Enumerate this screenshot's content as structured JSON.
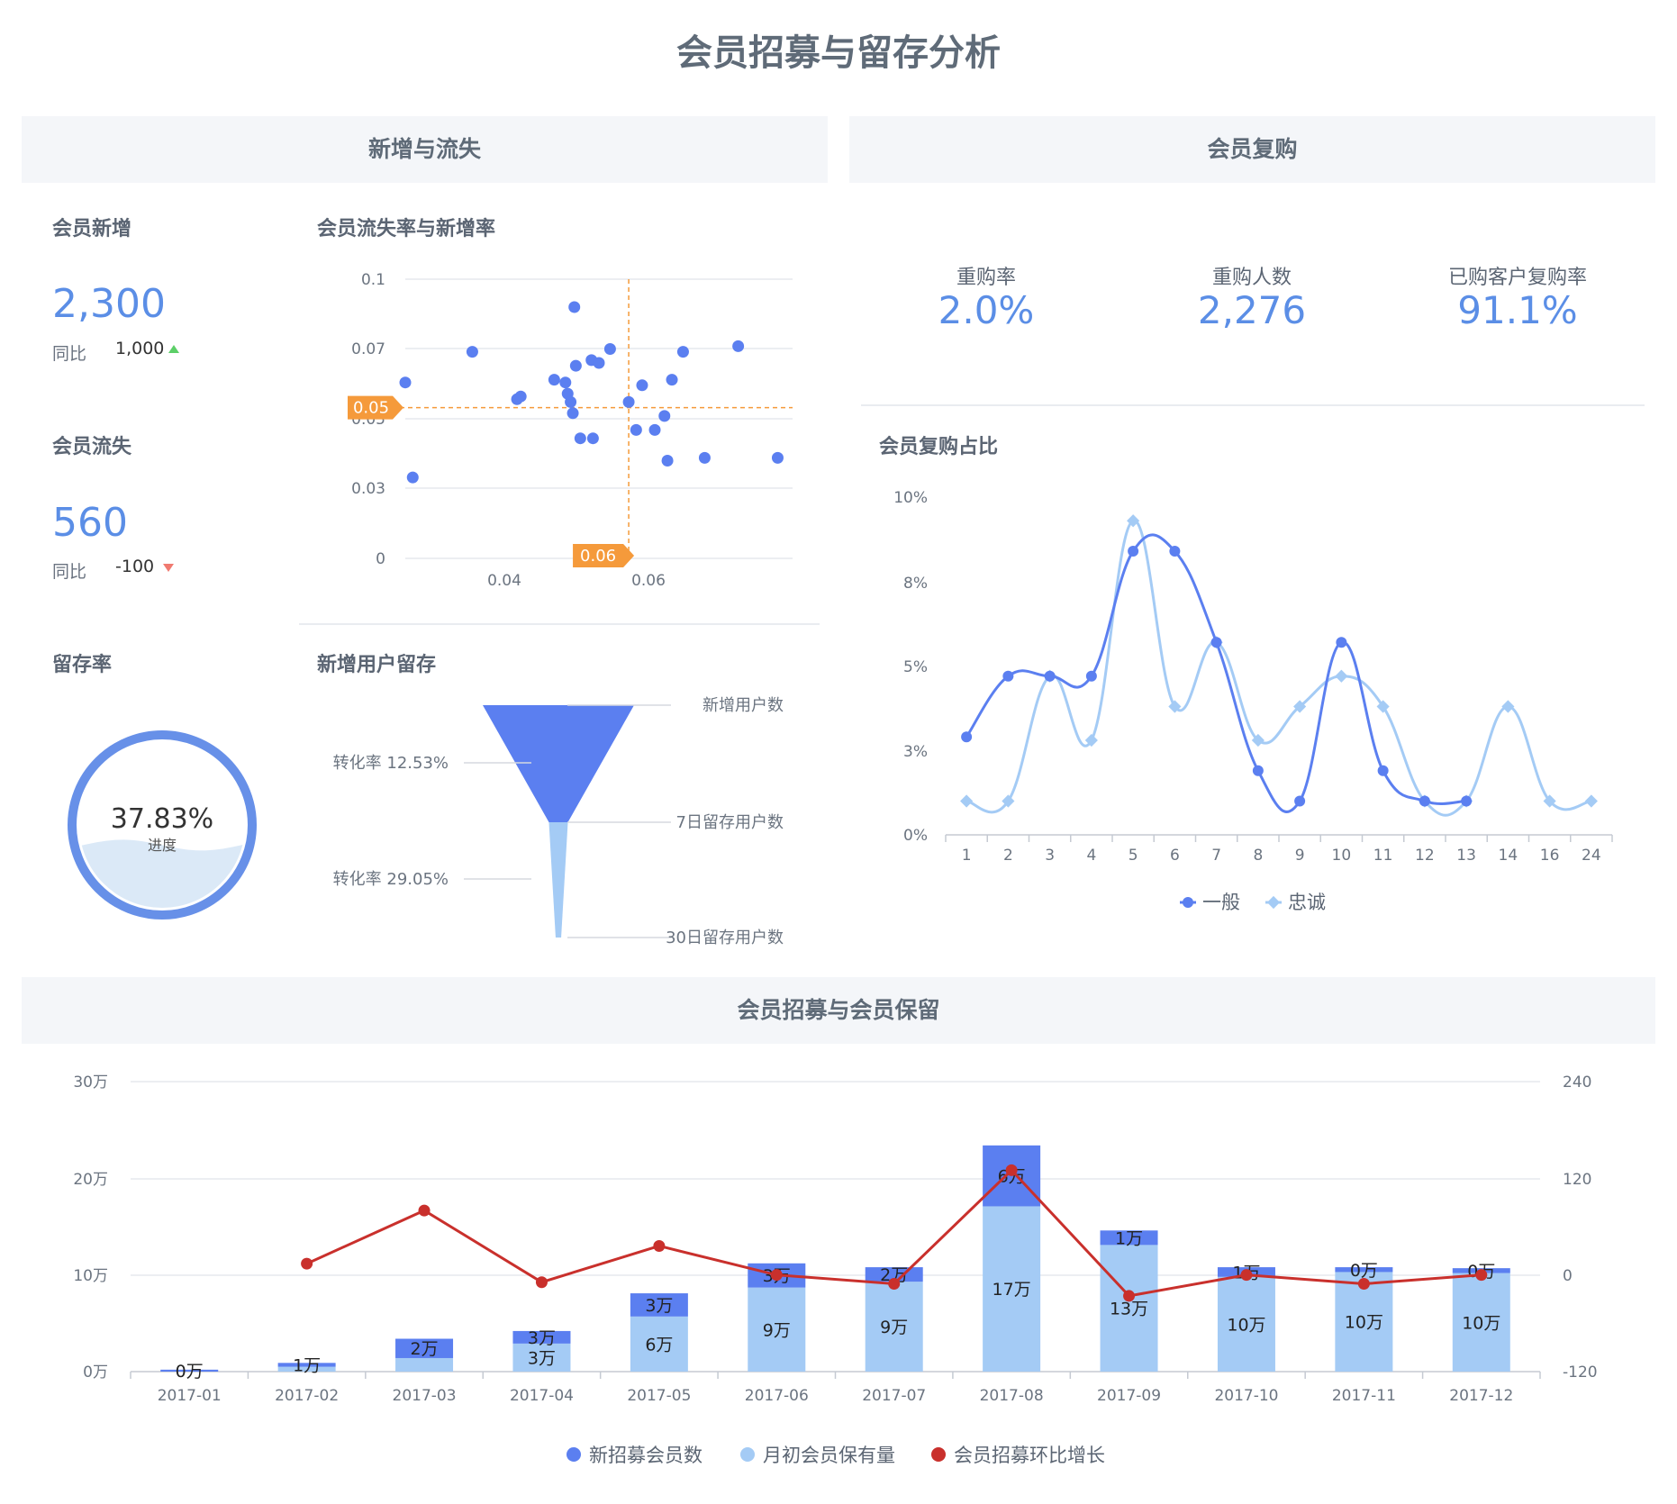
{
  "page_title": "会员招募与留存分析",
  "sections": {
    "new_and_lost": "新增与流失",
    "repurchase": "会员复购",
    "recruit_retain": "会员招募与会员保留"
  },
  "new_members": {
    "title": "会员新增",
    "value": "2,300",
    "yoy_label": "同比",
    "yoy_value": "1,000",
    "trend": "up"
  },
  "lost_members": {
    "title": "会员流失",
    "value": "560",
    "yoy_label": "同比",
    "yoy_value": "-100",
    "trend": "down"
  },
  "retention": {
    "title": "留存率",
    "value": "37.83%",
    "caption": "进度",
    "fraction": 0.3783
  },
  "funnel_title": "新增用户留存",
  "repurchase_kpis": [
    {
      "label": "重购率",
      "value": "2.0%"
    },
    {
      "label": "重购人数",
      "value": "2,276"
    },
    {
      "label": "已购客户复购率",
      "value": "91.1%"
    }
  ],
  "colors": {
    "accent": "#5b7ff0",
    "light": "#a4cbf5",
    "red": "#c9302c",
    "orange": "#f59a3b",
    "green": "#5ccf68",
    "down": "#f07a70"
  },
  "chart_data": [
    {
      "type": "scatter",
      "title": "会员流失率与新增率",
      "x_ticks": [
        "0.04",
        "0.06"
      ],
      "y_ticks": [
        "0",
        "0.03",
        "0.05",
        "0.07",
        "0.1"
      ],
      "xlim": [
        0.027,
        0.079
      ],
      "ylim": [
        0,
        0.1
      ],
      "mark_x": {
        "value": 0.057,
        "label": "0.06"
      },
      "mark_y": {
        "value": 0.054,
        "label": "0.05"
      },
      "points": [
        [
          0.027,
          0.063
        ],
        [
          0.028,
          0.029
        ],
        [
          0.036,
          0.074
        ],
        [
          0.042,
          0.057
        ],
        [
          0.0425,
          0.058
        ],
        [
          0.047,
          0.064
        ],
        [
          0.0485,
          0.063
        ],
        [
          0.0488,
          0.059
        ],
        [
          0.0492,
          0.056
        ],
        [
          0.0495,
          0.052
        ],
        [
          0.0497,
          0.09
        ],
        [
          0.0499,
          0.069
        ],
        [
          0.0505,
          0.043
        ],
        [
          0.052,
          0.071
        ],
        [
          0.0522,
          0.043
        ],
        [
          0.053,
          0.07
        ],
        [
          0.0545,
          0.075
        ],
        [
          0.057,
          0.056
        ],
        [
          0.058,
          0.046
        ],
        [
          0.0588,
          0.062
        ],
        [
          0.0605,
          0.046
        ],
        [
          0.0618,
          0.051
        ],
        [
          0.0622,
          0.035
        ],
        [
          0.0628,
          0.064
        ],
        [
          0.0643,
          0.074
        ],
        [
          0.0672,
          0.036
        ],
        [
          0.0717,
          0.076
        ],
        [
          0.077,
          0.036
        ]
      ]
    },
    {
      "type": "funnel",
      "title": "新增用户留存",
      "stages": [
        "新增用户数",
        "7日留存用户数",
        "30日留存用户数"
      ],
      "values": [
        100,
        12.53,
        3.64
      ],
      "rates": [
        "转化率 12.53%",
        "转化率 29.05%"
      ]
    },
    {
      "type": "line",
      "title": "会员复购占比",
      "categories": [
        "1",
        "2",
        "3",
        "4",
        "5",
        "6",
        "7",
        "8",
        "9",
        "10",
        "11",
        "12",
        "13",
        "14",
        "16",
        "24"
      ],
      "y_ticks": [
        "0%",
        "3%",
        "5%",
        "8%",
        "10%"
      ],
      "ylim": [
        0,
        10
      ],
      "series": [
        {
          "name": "一般",
          "color": "#5b7ff0",
          "values": [
            2.9,
            4.7,
            4.7,
            4.7,
            8.4,
            8.4,
            5.7,
            1.9,
            1.0,
            5.7,
            1.9,
            1.0,
            1.0,
            null,
            null,
            null
          ]
        },
        {
          "name": "忠诚",
          "color": "#a4cbf5",
          "values": [
            1.0,
            1.0,
            4.7,
            2.8,
            9.3,
            3.8,
            5.7,
            2.8,
            3.8,
            4.7,
            3.8,
            1.0,
            1.0,
            3.8,
            1.0,
            1.0
          ]
        }
      ],
      "legend": "bottom"
    },
    {
      "type": "bar",
      "title": "",
      "categories": [
        "2017-01",
        "2017-02",
        "2017-03",
        "2017-04",
        "2017-05",
        "2017-06",
        "2017-07",
        "2017-08",
        "2017-09",
        "2017-10",
        "2017-11",
        "2017-12"
      ],
      "y_ticks": [
        "0万",
        "10万",
        "20万",
        "30万"
      ],
      "y2_ticks": [
        "-120",
        "0",
        "120",
        "240"
      ],
      "ylim": [
        0,
        30
      ],
      "y2lim": [
        -120,
        240
      ],
      "series": [
        {
          "name": "新招募会员数",
          "color": "#5b7ff0",
          "values": [
            0.2,
            0.4,
            2,
            1.3,
            2.4,
            2.5,
            1.5,
            6.3,
            1.5,
            1.0,
            0.5,
            0.5
          ],
          "labels": [
            "0万",
            "1万",
            "2万",
            "3万",
            "3万",
            "3万",
            "2万",
            "6万",
            "1万",
            "1万",
            "0万",
            "0万"
          ]
        },
        {
          "name": "月初会员保有量",
          "color": "#a4cbf5",
          "values": [
            0,
            0.5,
            1.4,
            2.9,
            5.7,
            8.7,
            9.3,
            17.1,
            13.1,
            9.8,
            10.3,
            10.2
          ],
          "labels": [
            "",
            "",
            "",
            "3万",
            "6万",
            "9万",
            "9万",
            "17万",
            "13万",
            "10万",
            "10万",
            "10万"
          ]
        },
        {
          "name": "会员招募环比增长",
          "color": "#c9302c",
          "axis": "right",
          "values": [
            null,
            14,
            80,
            -9,
            36,
            0,
            -11,
            130,
            -26,
            0,
            -11,
            0
          ]
        }
      ],
      "legend": "bottom"
    }
  ]
}
